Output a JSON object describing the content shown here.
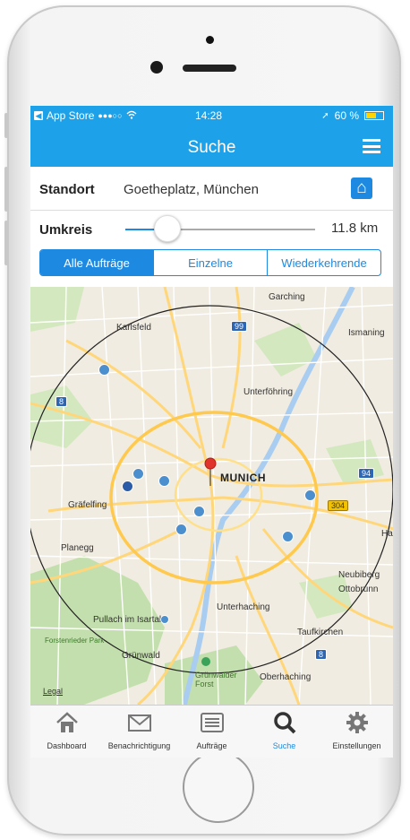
{
  "status_bar": {
    "back_app": "App Store",
    "signal": "●●●○○",
    "wifi": "wifi-icon",
    "time": "14:28",
    "battery_text": "60 %"
  },
  "navbar": {
    "title": "Suche",
    "menu_icon": "list-icon"
  },
  "location": {
    "label": "Standort",
    "value": "Goetheplatz, München",
    "home_icon": "home-icon"
  },
  "radius": {
    "label": "Umkreis",
    "value_text": "11.8 km",
    "slider_fraction": 0.22
  },
  "segments": [
    {
      "label": "Alle Aufträge",
      "active": true
    },
    {
      "label": "Einzelne",
      "active": false
    },
    {
      "label": "Wiederkehrende",
      "active": false
    }
  ],
  "map": {
    "city": "MUNICH",
    "labels": [
      "Garching",
      "Karlsfeld",
      "Ismaning",
      "Unterföhring",
      "Gräfelfing",
      "Planegg",
      "Neubiberg",
      "Ottobrunn",
      "Unterhaching",
      "Taufkirchen",
      "Pullach im Isartal",
      "Forstenrieder Park",
      "Grünwald",
      "Grünwalder Forst",
      "Oberhaching",
      "Ha"
    ],
    "road_shields": [
      "99",
      "8",
      "94",
      "304",
      "8"
    ],
    "legal": "Legal",
    "colors": {
      "water": "#a9cdf0",
      "park": "#c4dfae",
      "road": "#ffd77a",
      "marker": "#4b8fcf",
      "pin": "#e0332b"
    }
  },
  "tabs": [
    {
      "label": "Dashboard",
      "icon": "house-icon"
    },
    {
      "label": "Benachrichtigung",
      "icon": "envelope-icon"
    },
    {
      "label": "Aufträge",
      "icon": "list-icon"
    },
    {
      "label": "Suche",
      "icon": "search-icon",
      "active": true
    },
    {
      "label": "Einstellungen",
      "icon": "gear-icon"
    }
  ],
  "accent": "#1da1e8"
}
